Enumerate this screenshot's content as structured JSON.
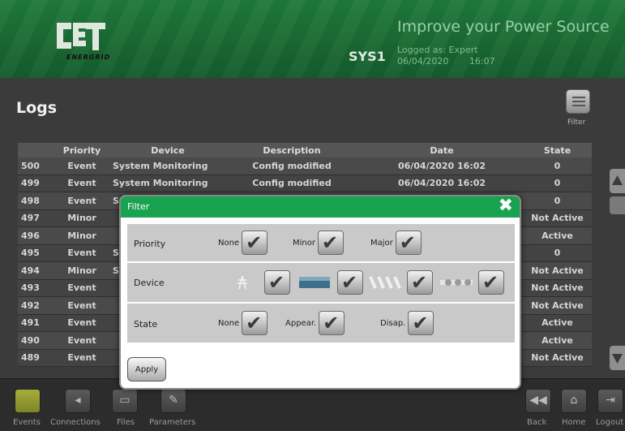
{
  "header": {
    "brand": "CET",
    "brand_sub": "ENERGRID",
    "system": "SYS1",
    "tagline": "Improve your Power Source",
    "logged_as": "Logged as: Expert",
    "date": "06/04/2020",
    "time": "16:07"
  },
  "page": {
    "title": "Logs",
    "filter_label": "Filter"
  },
  "table": {
    "columns": [
      "",
      "Priority",
      "Device",
      "Description",
      "Date",
      "State"
    ],
    "rows": [
      {
        "id": "500",
        "priority": "Event",
        "device": "System Monitoring",
        "description": "Config modified",
        "date": "06/04/2020 16:02",
        "state": "0"
      },
      {
        "id": "499",
        "priority": "Event",
        "device": "System Monitoring",
        "description": "Config modified",
        "date": "06/04/2020 16:02",
        "state": "0"
      },
      {
        "id": "498",
        "priority": "Event",
        "device": "Sy",
        "description": "",
        "date": "",
        "state": "0"
      },
      {
        "id": "497",
        "priority": "Minor",
        "device": "",
        "description": "",
        "date": "",
        "state": "Not Active"
      },
      {
        "id": "496",
        "priority": "Minor",
        "device": "",
        "description": "",
        "date": "",
        "state": "Active"
      },
      {
        "id": "495",
        "priority": "Event",
        "device": "Sy",
        "description": "",
        "date": "",
        "state": "0"
      },
      {
        "id": "494",
        "priority": "Minor",
        "device": "Sy",
        "description": "",
        "date": "",
        "state": "Not Active"
      },
      {
        "id": "493",
        "priority": "Event",
        "device": "",
        "description": "",
        "date": "",
        "state": "Not Active"
      },
      {
        "id": "492",
        "priority": "Event",
        "device": "",
        "description": "",
        "date": "",
        "state": "Not Active"
      },
      {
        "id": "491",
        "priority": "Event",
        "device": "",
        "description": "",
        "date": "",
        "state": "Active"
      },
      {
        "id": "490",
        "priority": "Event",
        "device": "",
        "description": "",
        "date": "",
        "state": "Active"
      },
      {
        "id": "489",
        "priority": "Event",
        "device": "",
        "description": "",
        "date": "",
        "state": "Not Active"
      }
    ]
  },
  "modal": {
    "title": "Filter",
    "priority": {
      "label": "Priority",
      "options": [
        "None",
        "Minor",
        "Major"
      ]
    },
    "device": {
      "label": "Device",
      "icons": [
        "pylon-icon",
        "battery-icon",
        "wave-icon",
        "chain-icon"
      ]
    },
    "state": {
      "label": "State",
      "options": [
        "None",
        "Appear.",
        "Disap."
      ]
    },
    "apply_label": "Apply"
  },
  "footer": {
    "events": "Events",
    "connections": "Connections",
    "files": "Files",
    "parameters": "Parameters",
    "back": "Back",
    "home": "Home",
    "logout": "Logout"
  },
  "colors": {
    "header_green": "#1f7a3c",
    "modal_green": "#19a24f",
    "events_active": "#a7ad3a"
  }
}
